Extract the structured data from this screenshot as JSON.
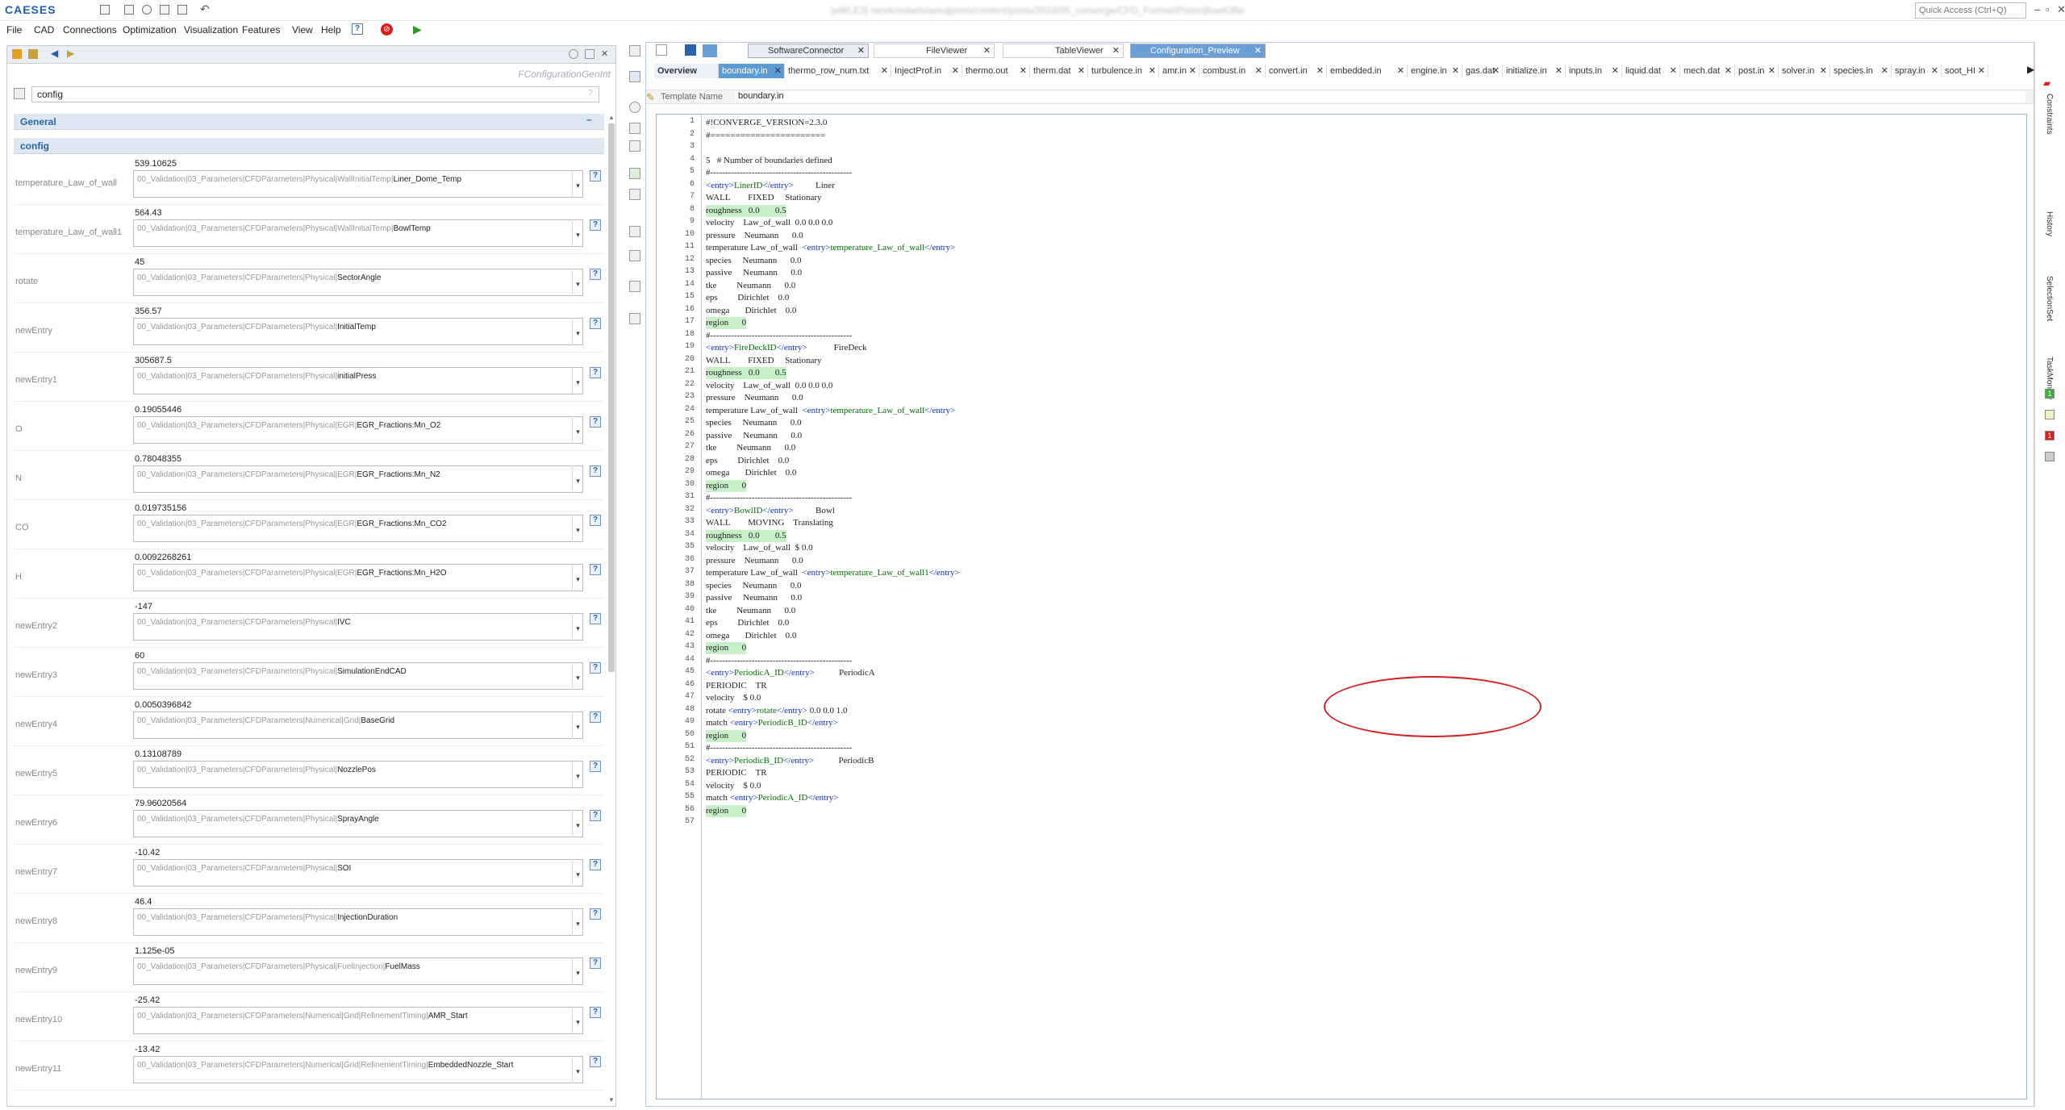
{
  "app": {
    "logo": "CAESES",
    "window_title": "[eWLE3] /work/nobels/wordpress/content/posts/2018/05_converge/CFD_Format/PistonBowlOBe",
    "quick_access": "Quick Access (Ctrl+Q)"
  },
  "menu": [
    "File",
    "CAD",
    "Connections",
    "Optimization",
    "Visualization",
    "Features",
    "View",
    "Help"
  ],
  "left": {
    "header_label": "FConfigurationGenInt",
    "search_value": "config",
    "sections": [
      "General",
      "config"
    ],
    "rows": [
      {
        "label": "temperature_Law_of_wall",
        "value": "539.10625",
        "path": "00_Validation|03_Parameters|CFDParameters|Physical|WallInitialTemp|",
        "last": "Liner_Dome_Temp"
      },
      {
        "label": "temperature_Law_of_wall1",
        "value": "564.43",
        "path": "00_Validation|03_Parameters|CFDParameters|Physical|WallInitialTemp|",
        "last": "BowlTemp"
      },
      {
        "label": "rotate",
        "value": "45",
        "path": "00_Validation|03_Parameters|CFDParameters|Physical|",
        "last": "SectorAngle"
      },
      {
        "label": "newEntry",
        "value": "356.57",
        "path": "00_Validation|03_Parameters|CFDParameters|Physical|",
        "last": "InitialTemp"
      },
      {
        "label": "newEntry1",
        "value": "305687.5",
        "path": "00_Validation|03_Parameters|CFDParameters|Physical|",
        "last": "initialPress"
      },
      {
        "label": "O",
        "value": "0.19055446",
        "path": "00_Validation|03_Parameters|CFDParameters|Physical|EGR|",
        "last": "EGR_Fractions:Mn_O2"
      },
      {
        "label": "N",
        "value": "0.78048355",
        "path": "00_Validation|03_Parameters|CFDParameters|Physical|EGR|",
        "last": "EGR_Fractions:Mn_N2"
      },
      {
        "label": "CO",
        "value": "0.019735156",
        "path": "00_Validation|03_Parameters|CFDParameters|Physical|EGR|",
        "last": "EGR_Fractions:Mn_CO2"
      },
      {
        "label": "H",
        "value": "0.0092268261",
        "path": "00_Validation|03_Parameters|CFDParameters|Physical|EGR|",
        "last": "EGR_Fractions:Mn_H2O"
      },
      {
        "label": "newEntry2",
        "value": "-147",
        "path": "00_Validation|03_Parameters|CFDParameters|Physical|",
        "last": "IVC"
      },
      {
        "label": "newEntry3",
        "value": "60",
        "path": "00_Validation|03_Parameters|CFDParameters|Physical|",
        "last": "SimulationEndCAD"
      },
      {
        "label": "newEntry4",
        "value": "0.0050396842",
        "path": "00_Validation|03_Parameters|CFDParameters|Numerical|Grid|",
        "last": "BaseGrid"
      },
      {
        "label": "newEntry5",
        "value": "0.13108789",
        "path": "00_Validation|03_Parameters|CFDParameters|Physical|",
        "last": "NozzlePos"
      },
      {
        "label": "newEntry6",
        "value": "79.96020564",
        "path": "00_Validation|03_Parameters|CFDParameters|Physical|",
        "last": "SprayAngle"
      },
      {
        "label": "newEntry7",
        "value": "-10.42",
        "path": "00_Validation|03_Parameters|CFDParameters|Physical|",
        "last": "SOI"
      },
      {
        "label": "newEntry8",
        "value": "46.4",
        "path": "00_Validation|03_Parameters|CFDParameters|Physical|",
        "last": "InjectionDuration"
      },
      {
        "label": "newEntry9",
        "value": "1.125e-05",
        "path": "00_Validation|03_Parameters|CFDParameters|Physical|FuelInjection|",
        "last": "FuelMass"
      },
      {
        "label": "newEntry10",
        "value": "-25.42",
        "path": "00_Validation|03_Parameters|CFDParameters|Numerical|Grid|RefinementTiming|",
        "last": "AMR_Start"
      },
      {
        "label": "newEntry11",
        "value": "-13.42",
        "path": "00_Validation|03_Parameters|CFDParameters|Numerical|Grid|RefinementTiming|",
        "last": "EmbeddedNozzle_Start"
      }
    ]
  },
  "panel_tabs": [
    "SoftwareConnector",
    "FileViewer",
    "TableViewer",
    "Configuration_Preview"
  ],
  "doc_tabs": [
    "Overview",
    "boundary.in",
    "thermo_row_num.txt",
    "InjectProf.in",
    "thermo.out",
    "therm.dat",
    "turbulence.in",
    "amr.in",
    "combust.in",
    "convert.in",
    "embedded.in",
    "engine.in",
    "gas.dat",
    "initialize.in",
    "inputs.in",
    "liquid.dat",
    "mech.dat",
    "post.in",
    "solver.in",
    "species.in",
    "spray.in",
    "soot_HI"
  ],
  "template": {
    "label": "Template Name",
    "value": "boundary.in"
  },
  "side_tabs": [
    "Constraints",
    "History",
    "SelectionSet",
    "TaskMonitor"
  ],
  "code": [
    "#!CONVERGE_VERSION=2.3.0",
    "#=======================",
    "",
    "5   # Number of boundaries defined",
    "#------------------------------------------------",
    "<entry>LinerID</entry>          Liner",
    "WALL        FIXED     Stationary",
    "roughness   0.0       0.5",
    "velocity    Law_of_wall  0.0 0.0 0.0",
    "pressure    Neumann      0.0",
    "temperature Law_of_wall  <entry>temperature_Law_of_wall</entry>",
    "species     Neumann      0.0",
    "passive     Neumann      0.0",
    "tke         Neumann      0.0",
    "eps         Dirichlet    0.0",
    "omega       Dirichlet    0.0",
    "region      0",
    "#------------------------------------------------",
    "<entry>FireDeckID</entry>            FireDeck",
    "WALL        FIXED     Stationary",
    "roughness   0.0       0.5",
    "velocity    Law_of_wall  0.0 0.0 0.0",
    "pressure    Neumann      0.0",
    "temperature Law_of_wall  <entry>temperature_Law_of_wall</entry>",
    "species     Neumann      0.0",
    "passive     Neumann      0.0",
    "tke         Neumann      0.0",
    "eps         Dirichlet    0.0",
    "omega       Dirichlet    0.0",
    "region      0",
    "#------------------------------------------------",
    "<entry>BowlID</entry>          Bowl",
    "WALL        MOVING    Translating",
    "roughness   0.0       0.5",
    "velocity    Law_of_wall  $ 0.0",
    "pressure    Neumann      0.0",
    "temperature Law_of_wall  <entry>temperature_Law_of_wall1</entry>",
    "species     Neumann      0.0",
    "passive     Neumann      0.0",
    "tke         Neumann      0.0",
    "eps         Dirichlet    0.0",
    "omega       Dirichlet    0.0",
    "region      0",
    "#------------------------------------------------",
    "<entry>PeriodicA_ID</entry>           PeriodicA",
    "PERIODIC    TR",
    "velocity    $ 0.0",
    "rotate <entry>rotate</entry> 0.0 0.0 1.0",
    "match <entry>PeriodicB_ID</entry>",
    "region      0",
    "#------------------------------------------------",
    "<entry>PeriodicB_ID</entry>           PeriodicB",
    "PERIODIC    TR",
    "velocity    $ 0.0",
    "match <entry>PeriodicA_ID</entry>",
    "region      0",
    ""
  ]
}
